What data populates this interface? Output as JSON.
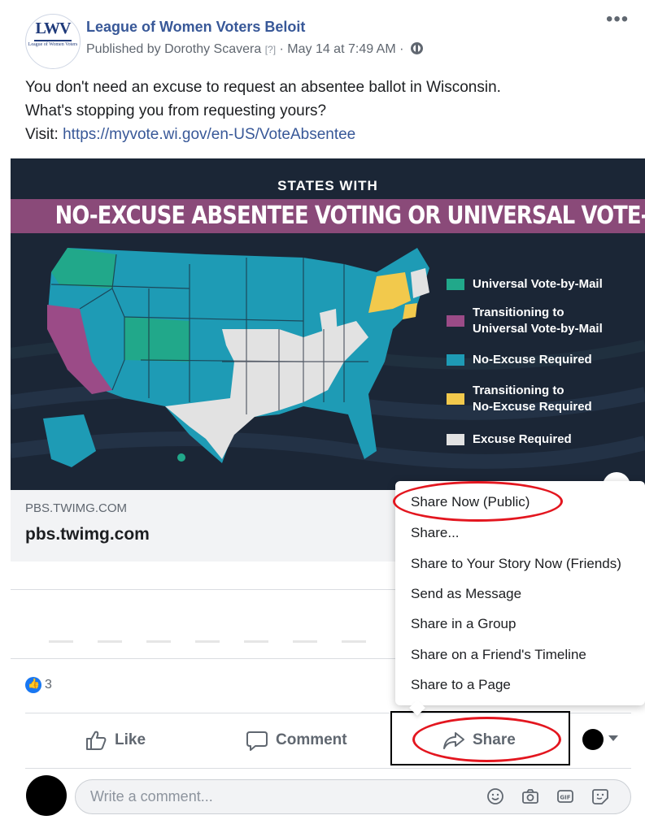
{
  "post": {
    "page_name": "League of Women Voters Beloit",
    "published_by": "Published by Dorothy Scavera",
    "help_marker": "[?]",
    "date": "May 14 at 7:49 AM",
    "separator": "·",
    "more_label": "•••",
    "logo_text": "LWV",
    "logo_subtext": "League of Women Voters",
    "text_line1": "You don't need an excuse to request an absentee ballot in Wisconsin.",
    "text_line2": "What's stopping you from requesting yours?",
    "text_visit": "Visit: ",
    "link": "https://myvote.wi.gov/en-US/VoteAbsentee"
  },
  "infographic": {
    "subtitle": "STATES WITH",
    "title": "NO-EXCUSE ABSENTEE VOTING OR UNIVERSAL VOTE-BY-MAIL",
    "legend": [
      {
        "label_line1": "Universal Vote-by-Mail",
        "label_line2": "",
        "color": "#21a88a"
      },
      {
        "label_line1": "Transitioning to",
        "label_line2": "Universal Vote-by-Mail",
        "color": "#9b4b87"
      },
      {
        "label_line1": "No-Excuse Required",
        "label_line2": "",
        "color": "#1e9bb5"
      },
      {
        "label_line1": "Transitioning to",
        "label_line2": "No-Excuse Required",
        "color": "#f2c94c"
      },
      {
        "label_line1": "Excuse Required",
        "label_line2": "",
        "color": "#e2e2e2"
      }
    ]
  },
  "preview": {
    "domain": "PBS.TWIMG.COM",
    "title": "pbs.twimg.com"
  },
  "reactions": {
    "count": "3"
  },
  "actions": {
    "like": "Like",
    "comment": "Comment",
    "share": "Share"
  },
  "composer": {
    "placeholder": "Write a comment..."
  },
  "share_menu": {
    "items": [
      "Share Now (Public)",
      "Share...",
      "Share to Your Story Now (Friends)",
      "Send as Message",
      "Share in a Group",
      "Share on a Friend's Timeline",
      "Share to a Page"
    ]
  },
  "colors": {
    "accent_link": "#385898",
    "highlight": "#e3161f",
    "like_blue": "#1877f2"
  }
}
